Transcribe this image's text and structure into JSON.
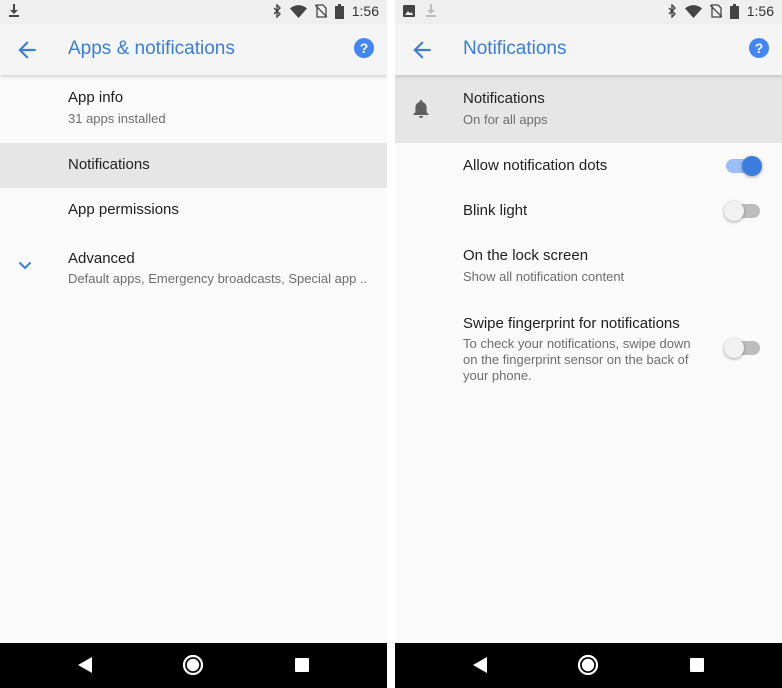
{
  "status_bar": {
    "time": "1:56"
  },
  "left": {
    "title": "Apps & notifications",
    "help": "?",
    "items": [
      {
        "title": "App info",
        "subtitle": "31 apps installed"
      },
      {
        "title": "Notifications"
      },
      {
        "title": "App permissions"
      },
      {
        "title": "Advanced",
        "subtitle": "Default apps, Emergency broadcasts, Special app .."
      }
    ]
  },
  "right": {
    "title": "Notifications",
    "help": "?",
    "items": [
      {
        "title": "Notifications",
        "subtitle": "On for all apps"
      },
      {
        "title": "Allow notification dots",
        "toggle": "on"
      },
      {
        "title": "Blink light",
        "toggle": "off"
      },
      {
        "title": "On the lock screen",
        "subtitle": "Show all notification content"
      },
      {
        "title": "Swipe fingerprint for notifications",
        "subtitle": "To check your notifications, swipe down on the fingerprint sensor on the back of your phone.",
        "toggle": "off"
      }
    ]
  },
  "colors": {
    "accent": "#3b7ddd",
    "help_bg": "#4285f4",
    "highlight": "#e6e6e6",
    "nav_bg": "#000000"
  },
  "icons": [
    "download-icon",
    "image-icon",
    "bluetooth-icon",
    "wifi-icon",
    "no-sim-icon",
    "battery-icon",
    "back-arrow-icon",
    "help-icon",
    "chevron-down-icon",
    "bell-icon",
    "nav-back-icon",
    "nav-home-icon",
    "nav-recents-icon"
  ]
}
